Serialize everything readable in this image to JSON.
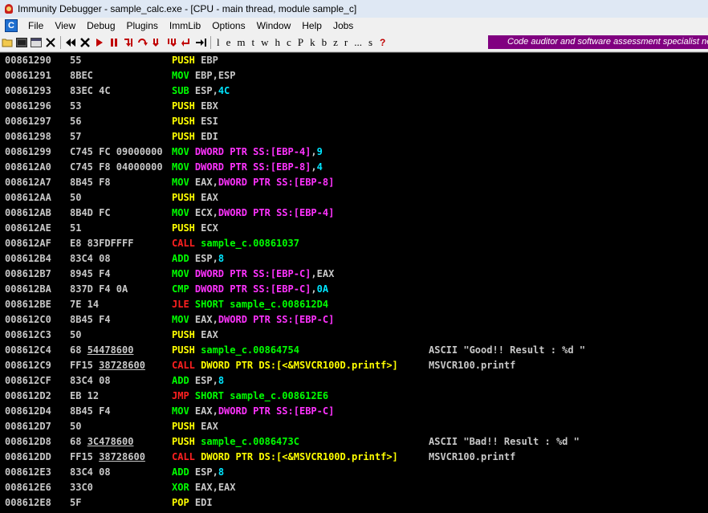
{
  "window": {
    "title": "Immunity Debugger - sample_calc.exe - [CPU - main thread, module sample_c]"
  },
  "menu": {
    "logo": "C",
    "items": [
      "File",
      "View",
      "Debug",
      "Plugins",
      "ImmLib",
      "Options",
      "Window",
      "Help",
      "Jobs"
    ]
  },
  "toolbar": {
    "letters": [
      "l",
      "e",
      "m",
      "t",
      "w",
      "h",
      "c",
      "P",
      "k",
      "b",
      "z",
      "r",
      "...",
      "s"
    ],
    "help": "?",
    "banner": "Code auditor and software assessment specialist needed"
  },
  "colors": {
    "push": "#ffff00",
    "mov": "#00ff00",
    "call": "#ff2020",
    "memory_operand": "#ff33ff",
    "immediate": "#00e5ff",
    "banner": "#800080"
  },
  "disassembly": [
    {
      "addr": "00861290",
      "hex": "55",
      "mnem": "PUSH",
      "kind": "push",
      "ops": [
        {
          "t": "EBP",
          "k": "reg"
        }
      ],
      "comment": ""
    },
    {
      "addr": "00861291",
      "hex": "8BEC",
      "mnem": "MOV",
      "kind": "mov",
      "ops": [
        {
          "t": "EBP",
          "k": "reg"
        },
        {
          "t": ",",
          "k": "reg"
        },
        {
          "t": "ESP",
          "k": "reg"
        }
      ],
      "comment": ""
    },
    {
      "addr": "00861293",
      "hex": "83EC 4C",
      "mnem": "SUB",
      "kind": "arith",
      "ops": [
        {
          "t": "ESP",
          "k": "reg"
        },
        {
          "t": ",",
          "k": "reg"
        },
        {
          "t": "4C",
          "k": "imm"
        }
      ],
      "comment": ""
    },
    {
      "addr": "00861296",
      "hex": "53",
      "mnem": "PUSH",
      "kind": "push",
      "ops": [
        {
          "t": "EBX",
          "k": "reg"
        }
      ],
      "comment": ""
    },
    {
      "addr": "00861297",
      "hex": "56",
      "mnem": "PUSH",
      "kind": "push",
      "ops": [
        {
          "t": "ESI",
          "k": "reg"
        }
      ],
      "comment": ""
    },
    {
      "addr": "00861298",
      "hex": "57",
      "mnem": "PUSH",
      "kind": "push",
      "ops": [
        {
          "t": "EDI",
          "k": "reg"
        }
      ],
      "comment": ""
    },
    {
      "addr": "00861299",
      "hex": "C745 FC 09000000",
      "mnem": "MOV",
      "kind": "mov",
      "ops": [
        {
          "t": "DWORD PTR SS:[EBP-4]",
          "k": "mem"
        },
        {
          "t": ",",
          "k": "reg"
        },
        {
          "t": "9",
          "k": "imm"
        }
      ],
      "comment": ""
    },
    {
      "addr": "008612A0",
      "hex": "C745 F8 04000000",
      "mnem": "MOV",
      "kind": "mov",
      "ops": [
        {
          "t": "DWORD PTR SS:[EBP-8]",
          "k": "mem"
        },
        {
          "t": ",",
          "k": "reg"
        },
        {
          "t": "4",
          "k": "imm"
        }
      ],
      "comment": ""
    },
    {
      "addr": "008612A7",
      "hex": "8B45 F8",
      "mnem": "MOV",
      "kind": "mov",
      "ops": [
        {
          "t": "EAX",
          "k": "reg"
        },
        {
          "t": ",",
          "k": "reg"
        },
        {
          "t": "DWORD PTR SS:[EBP-8]",
          "k": "mem"
        }
      ],
      "comment": ""
    },
    {
      "addr": "008612AA",
      "hex": "50",
      "mnem": "PUSH",
      "kind": "push",
      "ops": [
        {
          "t": "EAX",
          "k": "reg"
        }
      ],
      "comment": ""
    },
    {
      "addr": "008612AB",
      "hex": "8B4D FC",
      "mnem": "MOV",
      "kind": "mov",
      "ops": [
        {
          "t": "ECX",
          "k": "reg"
        },
        {
          "t": ",",
          "k": "reg"
        },
        {
          "t": "DWORD PTR SS:[EBP-4]",
          "k": "mem"
        }
      ],
      "comment": ""
    },
    {
      "addr": "008612AE",
      "hex": "51",
      "mnem": "PUSH",
      "kind": "push",
      "ops": [
        {
          "t": "ECX",
          "k": "reg"
        }
      ],
      "comment": ""
    },
    {
      "addr": "008612AF",
      "hex": "E8 83FDFFFF",
      "mnem": "CALL",
      "kind": "call",
      "ops": [
        {
          "t": "sample_c.00861037",
          "k": "sym"
        }
      ],
      "comment": ""
    },
    {
      "addr": "008612B4",
      "hex": "83C4 08",
      "mnem": "ADD",
      "kind": "arith",
      "ops": [
        {
          "t": "ESP",
          "k": "reg"
        },
        {
          "t": ",",
          "k": "reg"
        },
        {
          "t": "8",
          "k": "imm"
        }
      ],
      "comment": ""
    },
    {
      "addr": "008612B7",
      "hex": "8945 F4",
      "mnem": "MOV",
      "kind": "mov",
      "ops": [
        {
          "t": "DWORD PTR SS:[EBP-C]",
          "k": "mem"
        },
        {
          "t": ",",
          "k": "reg"
        },
        {
          "t": "EAX",
          "k": "reg"
        }
      ],
      "comment": ""
    },
    {
      "addr": "008612BA",
      "hex": "837D F4 0A",
      "mnem": "CMP",
      "kind": "arith",
      "ops": [
        {
          "t": "DWORD PTR SS:[EBP-C]",
          "k": "mem"
        },
        {
          "t": ",",
          "k": "reg"
        },
        {
          "t": "0A",
          "k": "imm"
        }
      ],
      "comment": ""
    },
    {
      "addr": "008612BE",
      "hex": "7E 14",
      "mnem": "JLE",
      "kind": "jmp",
      "ops": [
        {
          "t": "SHORT sample_c.008612D4",
          "k": "sym"
        }
      ],
      "comment": ""
    },
    {
      "addr": "008612C0",
      "hex": "8B45 F4",
      "mnem": "MOV",
      "kind": "mov",
      "ops": [
        {
          "t": "EAX",
          "k": "reg"
        },
        {
          "t": ",",
          "k": "reg"
        },
        {
          "t": "DWORD PTR SS:[EBP-C]",
          "k": "mem"
        }
      ],
      "comment": ""
    },
    {
      "addr": "008612C3",
      "hex": "50",
      "mnem": "PUSH",
      "kind": "push",
      "ops": [
        {
          "t": "EAX",
          "k": "reg"
        }
      ],
      "comment": ""
    },
    {
      "addr": "008612C4",
      "hex": "68 54478600",
      "hexU": "54478600",
      "mnem": "PUSH",
      "kind": "push",
      "ops": [
        {
          "t": "sample_c.00864754",
          "k": "sym"
        }
      ],
      "comment": "ASCII \"Good!! Result : %d \""
    },
    {
      "addr": "008612C9",
      "hex": "FF15 38728600",
      "hexU": "38728600",
      "mnem": "CALL",
      "kind": "call",
      "ops": [
        {
          "t": "DWORD PTR DS:[<&MSVCR100D.printf>]",
          "k": "api"
        }
      ],
      "comment": "MSVCR100.printf"
    },
    {
      "addr": "008612CF",
      "hex": "83C4 08",
      "mnem": "ADD",
      "kind": "arith",
      "ops": [
        {
          "t": "ESP",
          "k": "reg"
        },
        {
          "t": ",",
          "k": "reg"
        },
        {
          "t": "8",
          "k": "imm"
        }
      ],
      "comment": ""
    },
    {
      "addr": "008612D2",
      "hex": "EB 12",
      "mnem": "JMP",
      "kind": "jmp",
      "ops": [
        {
          "t": "SHORT sample_c.008612E6",
          "k": "sym"
        }
      ],
      "comment": ""
    },
    {
      "addr": "008612D4",
      "hex": "8B45 F4",
      "mnem": "MOV",
      "kind": "mov",
      "ops": [
        {
          "t": "EAX",
          "k": "reg"
        },
        {
          "t": ",",
          "k": "reg"
        },
        {
          "t": "DWORD PTR SS:[EBP-C]",
          "k": "mem"
        }
      ],
      "comment": ""
    },
    {
      "addr": "008612D7",
      "hex": "50",
      "mnem": "PUSH",
      "kind": "push",
      "ops": [
        {
          "t": "EAX",
          "k": "reg"
        }
      ],
      "comment": ""
    },
    {
      "addr": "008612D8",
      "hex": "68 3C478600",
      "hexU": "3C478600",
      "mnem": "PUSH",
      "kind": "push",
      "ops": [
        {
          "t": "sample_c.0086473C",
          "k": "sym"
        }
      ],
      "comment": "ASCII \"Bad!! Result : %d \""
    },
    {
      "addr": "008612DD",
      "hex": "FF15 38728600",
      "hexU": "38728600",
      "mnem": "CALL",
      "kind": "call",
      "ops": [
        {
          "t": "DWORD PTR DS:[<&MSVCR100D.printf>]",
          "k": "api"
        }
      ],
      "comment": "MSVCR100.printf"
    },
    {
      "addr": "008612E3",
      "hex": "83C4 08",
      "mnem": "ADD",
      "kind": "arith",
      "ops": [
        {
          "t": "ESP",
          "k": "reg"
        },
        {
          "t": ",",
          "k": "reg"
        },
        {
          "t": "8",
          "k": "imm"
        }
      ],
      "comment": ""
    },
    {
      "addr": "008612E6",
      "hex": "33C0",
      "mnem": "XOR",
      "kind": "arith",
      "ops": [
        {
          "t": "EAX",
          "k": "reg"
        },
        {
          "t": ",",
          "k": "reg"
        },
        {
          "t": "EAX",
          "k": "reg"
        }
      ],
      "comment": ""
    },
    {
      "addr": "008612E8",
      "hex": "5F",
      "mnem": "POP",
      "kind": "pop",
      "ops": [
        {
          "t": "EDI",
          "k": "reg"
        }
      ],
      "comment": ""
    }
  ]
}
